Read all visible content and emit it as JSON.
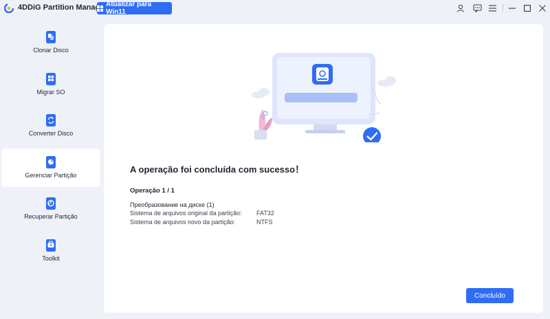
{
  "app": {
    "title": "4DDiG Partition Manager",
    "upgrade_label": "Atualizar para Win11",
    "accent_color": "#2f6df6"
  },
  "titlebar_icons": [
    "user-icon",
    "feedback-icon",
    "menu-icon",
    "minimize-icon",
    "maximize-icon",
    "close-icon"
  ],
  "sidebar": {
    "items": [
      {
        "label": "Clonar Disco",
        "icon": "clone-disk-icon",
        "active": false
      },
      {
        "label": "Migrar SO",
        "icon": "migrate-os-icon",
        "active": false
      },
      {
        "label": "Converter Disco",
        "icon": "convert-disk-icon",
        "active": false
      },
      {
        "label": "Gerenciar Partição",
        "icon": "manage-partition-icon",
        "active": true
      },
      {
        "label": "Recuperar Partição",
        "icon": "recover-partition-icon",
        "active": false
      },
      {
        "label": "Toolkit",
        "icon": "toolkit-icon",
        "active": false
      }
    ]
  },
  "main": {
    "result_title": "A operação foi concluída com sucesso！",
    "operation_count": "Operação 1 / 1",
    "operation_name": "Преобразование на диске (1)",
    "details": [
      {
        "label": "Sistema de arquivos original da partição:",
        "value": "FAT32"
      },
      {
        "label": "Sistema de arquivos novo da partição:",
        "value": "NTFS"
      }
    ],
    "done_label": "Concluído"
  }
}
